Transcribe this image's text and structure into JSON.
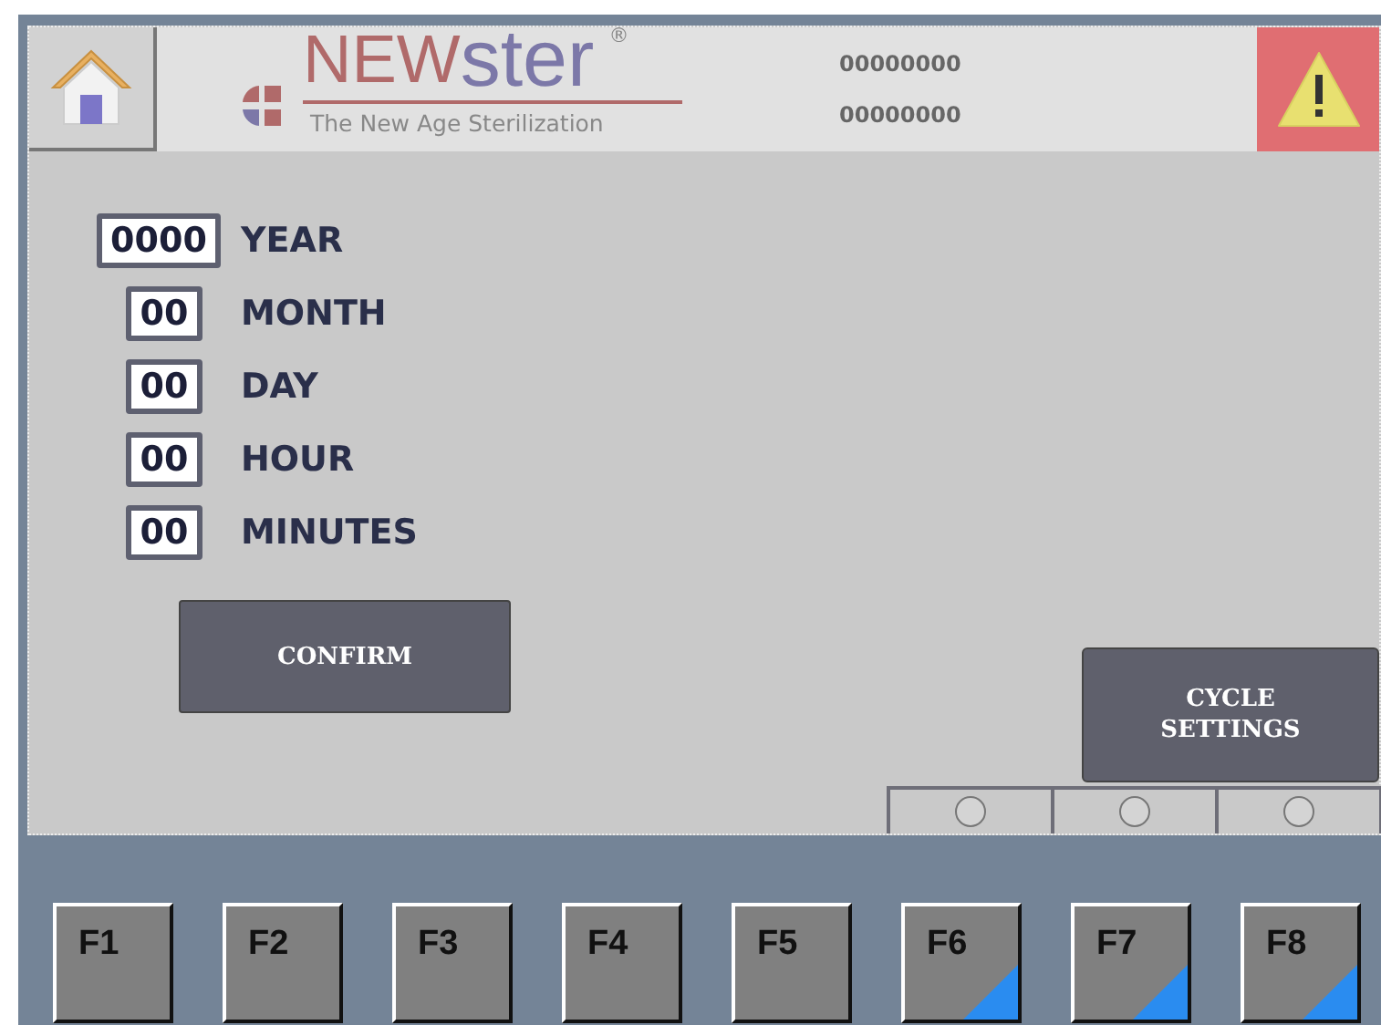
{
  "header": {
    "logo": {
      "part_1": "NEW",
      "part_2": "ster",
      "registered": "®",
      "tagline": "The New Age Sterilization"
    },
    "counters": [
      "00000000",
      "00000000"
    ]
  },
  "fields": [
    {
      "value": "0000",
      "label": "YEAR",
      "kind": "wide"
    },
    {
      "value": "00",
      "label": "MONTH",
      "kind": "narrow"
    },
    {
      "value": "00",
      "label": "DAY",
      "kind": "narrow"
    },
    {
      "value": "00",
      "label": "HOUR",
      "kind": "narrow"
    },
    {
      "value": "00",
      "label": "MINUTES",
      "kind": "narrow"
    }
  ],
  "confirm_button": "CONFIRM",
  "cycle_settings_button": "CYCLE SETTINGS",
  "indicators": [
    {
      "on": false
    },
    {
      "on": false
    },
    {
      "on": false
    }
  ],
  "function_keys": [
    {
      "label": "F1",
      "flagged": false
    },
    {
      "label": "F2",
      "flagged": false
    },
    {
      "label": "F3",
      "flagged": false
    },
    {
      "label": "F4",
      "flagged": false
    },
    {
      "label": "F5",
      "flagged": false
    },
    {
      "label": "F6",
      "flagged": true
    },
    {
      "label": "F7",
      "flagged": true
    },
    {
      "label": "F8",
      "flagged": true
    }
  ]
}
